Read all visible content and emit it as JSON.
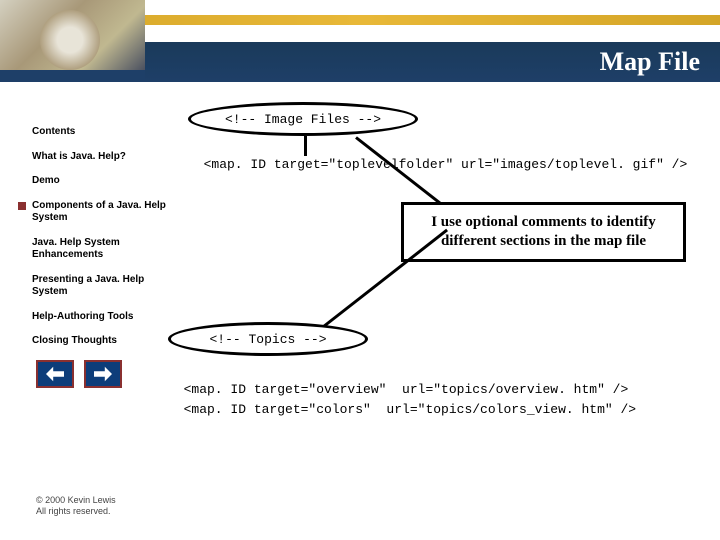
{
  "header": {
    "title": "Map File"
  },
  "sidebar": {
    "items": [
      {
        "label": "Contents",
        "active": false
      },
      {
        "label": "What is Java. Help?",
        "active": false
      },
      {
        "label": "Demo",
        "active": false
      },
      {
        "label": "Components of a Java. Help System",
        "active": true
      },
      {
        "label": "Java. Help System Enhancements",
        "active": false
      },
      {
        "label": "Presenting a Java. Help System",
        "active": false
      },
      {
        "label": "Help-Authoring Tools",
        "active": false
      },
      {
        "label": "Closing Thoughts",
        "active": false
      }
    ]
  },
  "content": {
    "comment1": "<!-- Image Files -->",
    "code1": "  <map. ID target=\"toplevelfolder\" url=\"images/toplevel. gif\" />",
    "comment2": "<!-- Topics -->",
    "code2": "  <map. ID target=\"overview\"  url=\"topics/overview. htm\" />",
    "code3": "  <map. ID target=\"colors\"  url=\"topics/colors_view. htm\" />",
    "callout": "I use optional comments to identify different sections in the map file"
  },
  "footer": {
    "line1": "© 2000 Kevin Lewis",
    "line2": "All rights reserved."
  }
}
